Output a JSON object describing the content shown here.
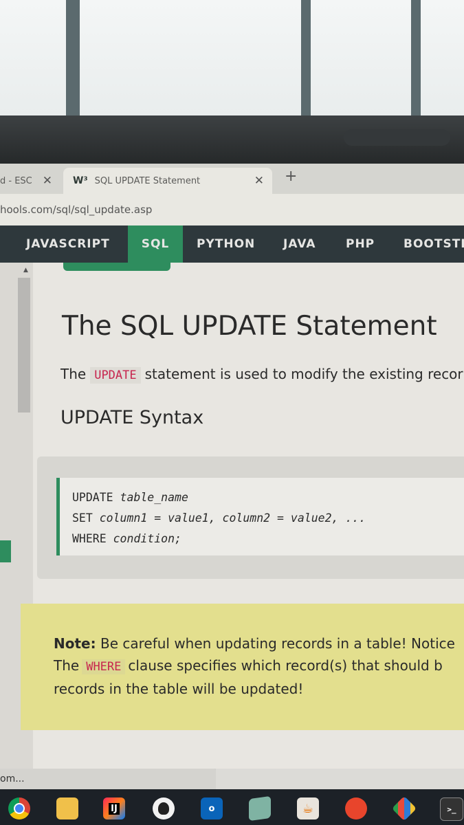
{
  "browser": {
    "tabs": [
      {
        "label": "d - ESC",
        "active": false
      },
      {
        "label": "SQL UPDATE Statement",
        "active": true,
        "favicon": "W³"
      }
    ],
    "new_tab_label": "+",
    "close_label": "✕",
    "url": "hools.com/sql/sql_update.asp"
  },
  "topnav": {
    "items": [
      "JAVASCRIPT",
      "SQL",
      "PYTHON",
      "JAVA",
      "PHP",
      "BOOTSTI"
    ],
    "active": "SQL"
  },
  "page": {
    "title": "The SQL UPDATE Statement",
    "intro_before": "The",
    "intro_code": "UPDATE",
    "intro_after": "statement is used to modify the existing recor",
    "syntax_heading": "UPDATE Syntax",
    "code_lines": [
      {
        "kw": "UPDATE",
        "rest": "table_name"
      },
      {
        "kw": "SET",
        "rest": "column1 = value1, column2 = value2, ..."
      },
      {
        "kw": "WHERE",
        "rest": "condition;"
      }
    ],
    "note": {
      "label": "Note:",
      "line1": "Be careful when updating records in a table! Notice",
      "line2_before": "The",
      "line2_code": "WHERE",
      "line2_after": "clause specifies which record(s) that should b",
      "line3": "records in the table will be updated!"
    }
  },
  "statusbar": {
    "text": "om..."
  },
  "taskbar": {
    "icons": [
      "chrome-icon",
      "file-explorer-icon",
      "intellij-icon",
      "inkscape-icon",
      "outlook-icon",
      "notepad-icon",
      "java-icon",
      "app-icon",
      "git-icon",
      "terminal-icon"
    ],
    "intellij_label": "IJ",
    "outlook_label": "o"
  },
  "colors": {
    "nav_bg": "#2e383c",
    "nav_active": "#2e8d5e",
    "code_red": "#c7254e",
    "note_bg": "#e3df8e"
  }
}
